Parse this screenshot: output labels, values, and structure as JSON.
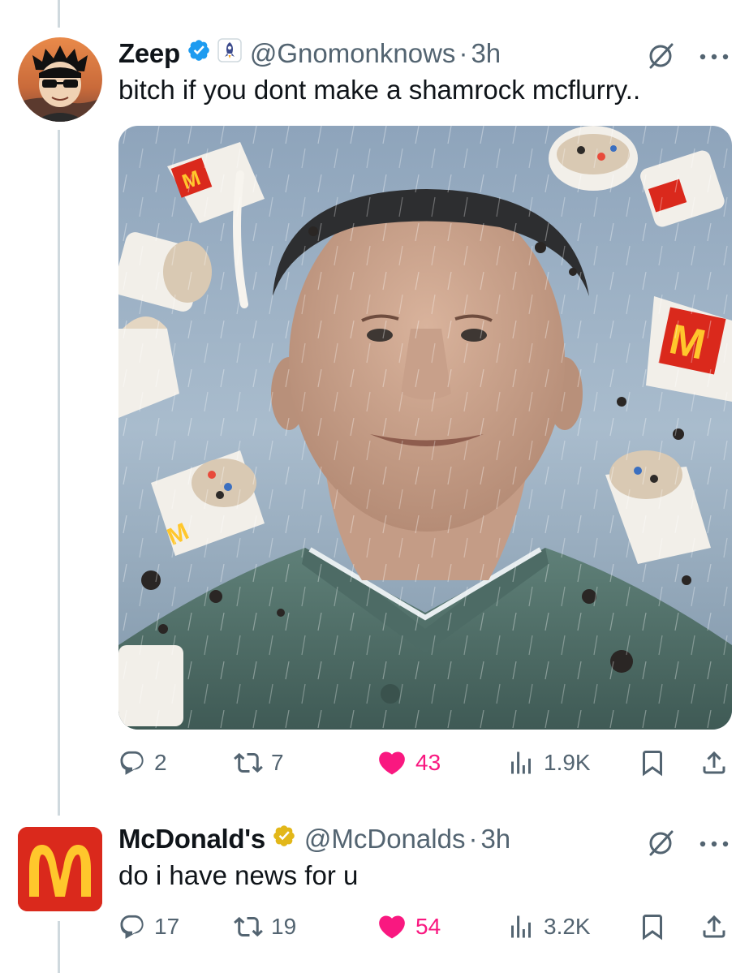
{
  "tweets": [
    {
      "name": "Zeep",
      "handle": "@Gnomonknows",
      "separator": "·",
      "time": "3h",
      "text": "bitch if you dont make a shamrock mcflurry..",
      "verified_color": "#1d9bf0",
      "image_description": "photo",
      "actions": {
        "replies": "2",
        "reposts": "7",
        "likes": "43",
        "views": "1.9K"
      }
    },
    {
      "name": "McDonald's",
      "handle": "@McDonalds",
      "separator": "·",
      "time": "3h",
      "text": "do i have news for u",
      "verified_color": "#e2b719",
      "actions": {
        "replies": "17",
        "reposts": "19",
        "likes": "54",
        "views": "3.2K"
      }
    }
  ],
  "colors": {
    "like": "#f91880",
    "muted": "#536471",
    "mcd_red": "#da291c",
    "mcd_yellow": "#ffc72c"
  },
  "icons": [
    "reply-icon",
    "repost-icon",
    "like-icon",
    "views-icon",
    "bookmark-icon",
    "share-icon",
    "grok-icon",
    "more-icon"
  ]
}
